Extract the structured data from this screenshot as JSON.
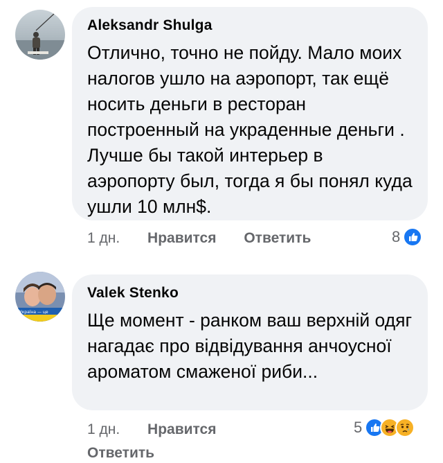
{
  "comments": [
    {
      "author": "Aleksandr Shulga",
      "text": "Отлично, точно не пойду. Мало моих налогов ушло на аэропорт, так ещё носить деньги в ресторан построенный на украденные деньги . Лучше бы такой интерьер в аэропорту был, тогда я бы понял куда ушли 10 млн$.",
      "time": "1 дн.",
      "like_label": "Нравится",
      "reply_label": "Ответить",
      "reaction_count": "8",
      "reactions": [
        "like-icon"
      ]
    },
    {
      "author": "Valek Stenko",
      "text": "Ще момент - ранком ваш верхній одяг нагадає про відвідування анчоусної ароматом смаженої риби...",
      "time": "1 дн.",
      "like_label": "Нравится",
      "reply_label": "Ответить",
      "reaction_count": "5",
      "reactions": [
        "like-icon",
        "haha-icon",
        "sad-icon"
      ]
    }
  ],
  "colors": {
    "bubble_bg": "#f0f2f5",
    "like_blue": "#1877f2",
    "secondary_text": "#65676b",
    "reaction_yellow": "#f7b125"
  }
}
